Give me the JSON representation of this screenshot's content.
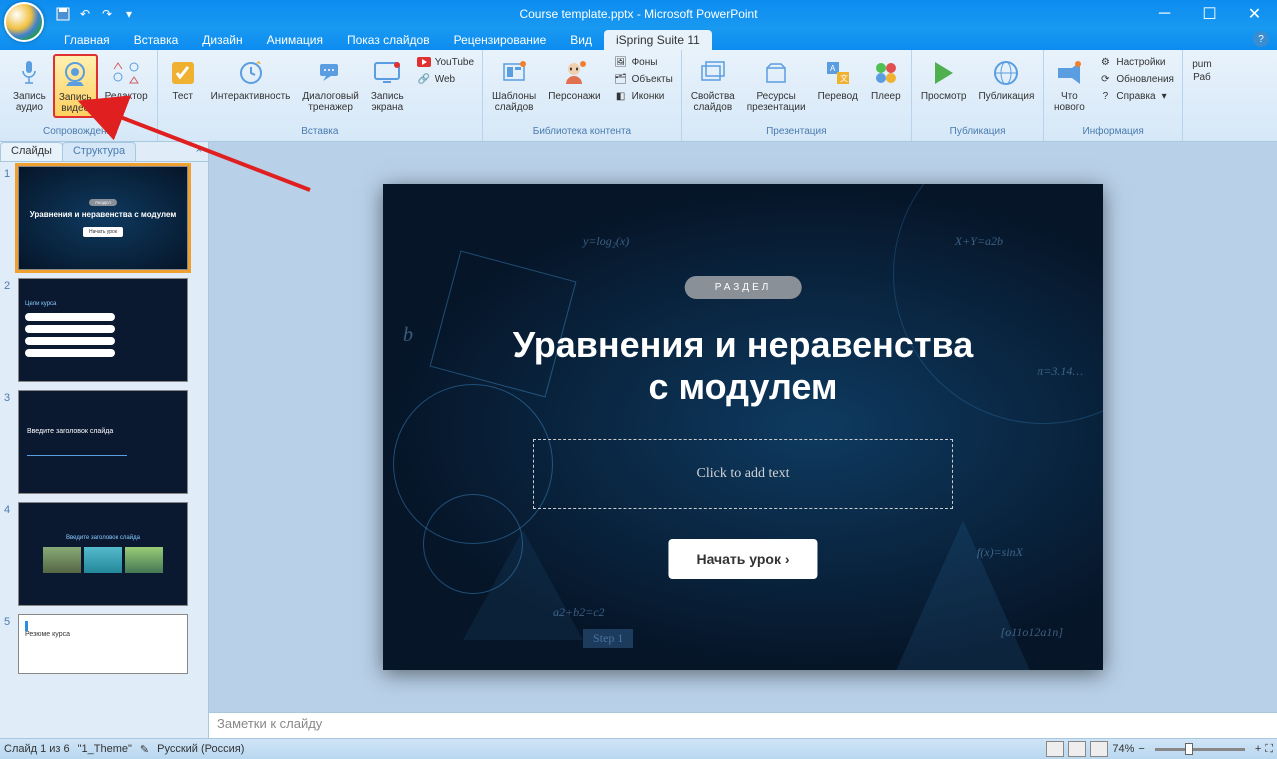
{
  "window": {
    "title": "Course template.pptx - Microsoft PowerPoint"
  },
  "tabs": {
    "home": "Главная",
    "insert": "Вставка",
    "design": "Дизайн",
    "animations": "Анимация",
    "slideshow": "Показ слайдов",
    "review": "Рецензирование",
    "view": "Вид",
    "ispring": "iSpring Suite 11"
  },
  "ribbon": {
    "group_narration": "Сопровождение",
    "group_insert": "Вставка",
    "group_library": "Библиотека контента",
    "group_presentation": "Презентация",
    "group_publish": "Публикация",
    "group_info": "Информация",
    "group_pum": "pum",
    "audio": "Запись\nаудио",
    "video": "Запись\nвидео",
    "editor": "Редактор",
    "quiz": "Тест",
    "interaction": "Интерактивность",
    "dialog": "Диалоговый\nтренажер",
    "screen": "Запись\nэкрана",
    "youtube": "YouTube",
    "web": "Web",
    "templates": "Шаблоны\nслайдов",
    "characters": "Персонажи",
    "backgrounds": "Фоны",
    "objects": "Объекты",
    "icons": "Иконки",
    "slideprops": "Свойства\nслайдов",
    "resources": "Ресурсы\nпрезентации",
    "translate": "Перевод",
    "player": "Плеер",
    "preview": "Просмотр",
    "publish": "Публикация",
    "whatsnew": "Что\nнового",
    "settings": "Настройки",
    "updates": "Обновления",
    "help": "Справка",
    "pum": "pum",
    "rab": "Раб"
  },
  "thumbs": {
    "tab_slides": "Слайды",
    "tab_outline": "Структура",
    "slides": [
      {
        "n": "1",
        "title": "Уравнения и неравенства\nс модулем",
        "selected": true
      },
      {
        "n": "2",
        "title": ""
      },
      {
        "n": "3",
        "title": "Введите заголовок\nслайда"
      },
      {
        "n": "4",
        "title": "Введите заголовок слайда"
      },
      {
        "n": "5",
        "title": "Резюме курса"
      }
    ]
  },
  "slide": {
    "badge": "РАЗДЕЛ",
    "title_line1": "Уравнения и неравенства",
    "title_line2": "с модулем",
    "placeholder": "Click to add text",
    "button": "Начать урок",
    "math_b": "b",
    "math_log": "y=log₂(x)",
    "math_xy": "X+Y=a2b",
    "math_pi": "π=3.14…",
    "math_c2": "a2+b2=c2",
    "math_step": "Step 1",
    "math_sin": "f(x)=sinX",
    "math_arr": "[o11o12a1n]"
  },
  "notes": {
    "placeholder": "Заметки к слайду"
  },
  "status": {
    "slide_of": "Слайд 1 из 6",
    "theme": "\"1_Theme\"",
    "lang": "Русский (Россия)",
    "zoom": "74%"
  }
}
